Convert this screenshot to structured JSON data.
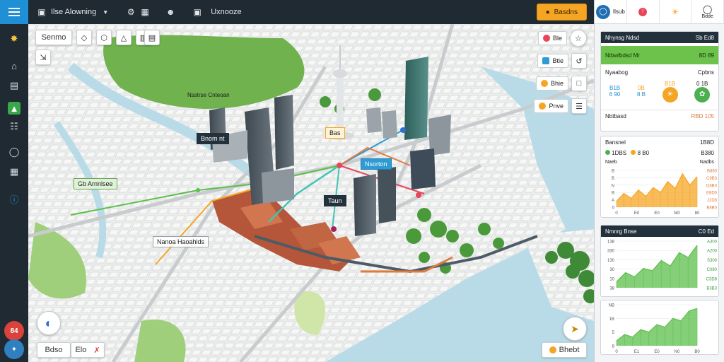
{
  "app": {
    "title": "Ilse Alowning",
    "search_label": "Uxnooze",
    "cta_label": "Basdns",
    "accent": "#1f8fd6",
    "cta_color": "#f5a524"
  },
  "rail": {
    "icons": [
      "compass-icon",
      "home-icon",
      "document-icon",
      "chart-icon",
      "book-icon",
      "globe-icon",
      "layers-icon",
      "help-icon"
    ],
    "badge_top": "84"
  },
  "map": {
    "search_button": "Senmo",
    "labels": {
      "park": "Nsstrse Cnteoan",
      "center": "Bnom nt",
      "tower": "Bas",
      "district_west": "Gb Arnnlsee",
      "district_south": "Nanoa Haoahlds",
      "road": "Nsorton",
      "station": "Taun"
    },
    "tools": [
      {
        "label": "Ble",
        "color": "#e8455a"
      },
      {
        "label": "Btie",
        "color": "#2f9bd3"
      },
      {
        "label": "Bhie",
        "color": "#f5a524"
      },
      {
        "label": "Pnve",
        "color": "#f5a524"
      }
    ],
    "bottom_left": {
      "label": "Bdso",
      "count": "Elo"
    },
    "bottom_right": {
      "label": "Bhebt"
    }
  },
  "panel": {
    "top_tabs": [
      {
        "label": "Ilsub",
        "icon": "globe-icon"
      },
      {
        "label": "",
        "icon": "alert-icon"
      },
      {
        "label": "",
        "icon": "lamp-icon"
      },
      {
        "label": "Bdde",
        "icon": "help-icon"
      }
    ],
    "card1": {
      "title": "Nhynsg Ndsd",
      "action": "Sb Ed8",
      "subtitle": "Ntbwlbdsd Mr",
      "sub_value": "8D 89",
      "head_left": "Nyaabog",
      "head_right": "Cpbns",
      "kpis": [
        {
          "top": "B1B",
          "bottom": "6 90"
        },
        {
          "top": "0B",
          "bottom": "8 B"
        },
        {
          "top": "B1B",
          "bottom": ""
        },
        {
          "top": "0 1B",
          "bottom": ""
        }
      ],
      "footer_left": "Nbtbasd",
      "footer_right": "RBD 105"
    },
    "card2": {
      "title": "Bansnel",
      "value": "1B8D",
      "legend": [
        {
          "label": "1DBS",
          "color": "#4caf50"
        },
        {
          "label": "8 B0",
          "color": "#f5a524"
        }
      ],
      "total": "B380",
      "axis_title_left": "Naeb",
      "axis_title_right": "Nadbs",
      "ylabels": [
        "B",
        "B",
        "N",
        "B",
        "A",
        "0"
      ],
      "right_labels": [
        "B880",
        "C9B3",
        "D8B0",
        "E8D0",
        "J2D8",
        "B8B0"
      ],
      "xlabels": [
        "0",
        "E0",
        "E0",
        "M0",
        "80"
      ],
      "chart_data": {
        "type": "area",
        "values": [
          12,
          28,
          18,
          35,
          22,
          40,
          30,
          52,
          38,
          68,
          45,
          62
        ],
        "color": "#f5a524"
      }
    },
    "card3": {
      "title": "Nmnrg Bnse",
      "action": "C0 Ed",
      "ylabels": [
        "138",
        "330",
        "130",
        "30",
        "10",
        "38"
      ],
      "right_labels": [
        "A300",
        "A200",
        "S300",
        "C080",
        "C3D8",
        "B3B3"
      ],
      "chart_data": {
        "type": "area",
        "values": [
          10,
          25,
          18,
          32,
          28,
          45,
          36,
          58,
          50,
          70
        ],
        "color": "#5cbf4b"
      }
    },
    "card4": {
      "ylabels": [
        "NB",
        "1B",
        "5",
        "8"
      ],
      "xlabels": [
        "0",
        "E1",
        "E0",
        "N0",
        "B0"
      ],
      "right_label": "5D3S",
      "chart_data": {
        "type": "area",
        "values": [
          8,
          18,
          14,
          26,
          22,
          34,
          30,
          44,
          40,
          56,
          60
        ],
        "color": "#5cbf4b"
      }
    }
  }
}
